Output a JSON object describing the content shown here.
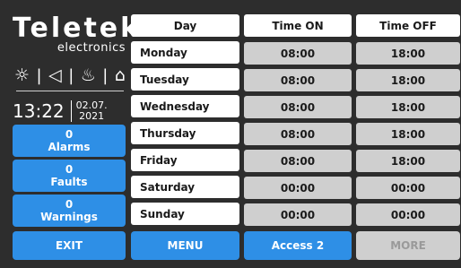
{
  "brand": {
    "name": "Teletek",
    "subtitle": "electronics"
  },
  "status_icons": [
    {
      "name": "sun-icon",
      "glyph": "☼"
    },
    {
      "name": "speaker-icon",
      "glyph": "◁"
    },
    {
      "name": "flame-icon",
      "glyph": "♨"
    },
    {
      "name": "door-icon",
      "glyph": "⌂"
    }
  ],
  "clock": {
    "time": "13:22",
    "date_line1": "02.07.",
    "date_line2": "2021"
  },
  "status": {
    "alarms": {
      "count": "0",
      "label": "Alarms"
    },
    "faults": {
      "count": "0",
      "label": "Faults"
    },
    "warnings": {
      "count": "0",
      "label": "Warnings"
    }
  },
  "table": {
    "headers": [
      "Day",
      "Time ON",
      "Time OFF"
    ],
    "rows": [
      {
        "day": "Monday",
        "on": "08:00",
        "off": "18:00"
      },
      {
        "day": "Tuesday",
        "on": "08:00",
        "off": "18:00"
      },
      {
        "day": "Wednesday",
        "on": "08:00",
        "off": "18:00"
      },
      {
        "day": "Thursday",
        "on": "08:00",
        "off": "18:00"
      },
      {
        "day": "Friday",
        "on": "08:00",
        "off": "18:00"
      },
      {
        "day": "Saturday",
        "on": "00:00",
        "off": "00:00"
      },
      {
        "day": "Sunday",
        "on": "00:00",
        "off": "00:00"
      }
    ]
  },
  "bottom": {
    "exit": "EXIT",
    "menu": "MENU",
    "access": "Access 2",
    "more": "MORE"
  },
  "colors": {
    "accent": "#2e8fe6",
    "background": "#2d2d2d",
    "cell_value": "#cfcfcf",
    "disabled": "#cfcfcf"
  }
}
